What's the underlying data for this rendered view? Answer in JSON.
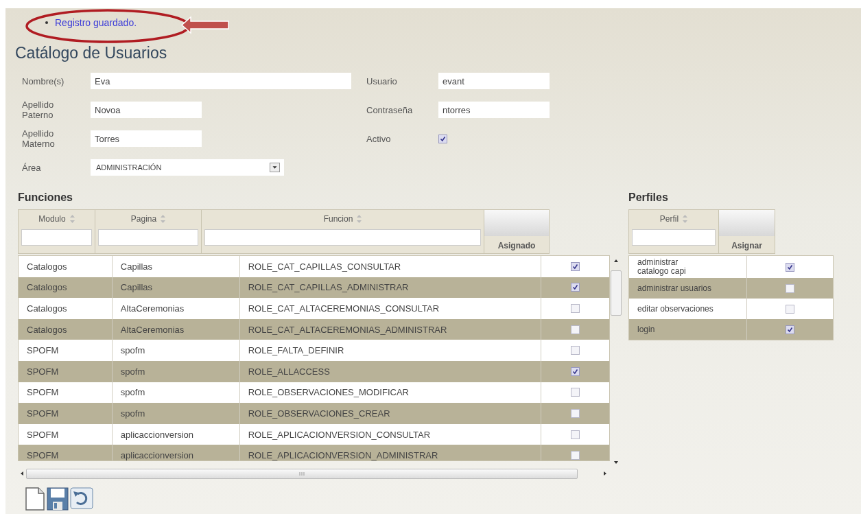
{
  "message": "Registro guardado.",
  "title": "Catálogo de Usuarios",
  "form": {
    "left": [
      {
        "label": "Nombre(s)",
        "value": "Eva",
        "wide": true
      },
      {
        "label": "Apellido Paterno",
        "value": "Novoa",
        "wide": false
      },
      {
        "label": "Apellido Materno",
        "value": "Torres",
        "wide": false
      }
    ],
    "right": [
      {
        "label": "Usuario",
        "value": "evant",
        "kind": "text"
      },
      {
        "label": "Contraseña",
        "value": "ntorres",
        "kind": "text"
      },
      {
        "label": "Activo",
        "checked": true,
        "kind": "checkbox"
      }
    ],
    "area": {
      "label": "Área",
      "value": "ADMINISTRACIÓN"
    }
  },
  "funciones": {
    "title": "Funciones",
    "columns": [
      "Modulo",
      "Pagina",
      "Funcion",
      "Asignado"
    ],
    "rows": [
      {
        "modulo": "Catalogos",
        "pagina": "Capillas",
        "funcion": "ROLE_CAT_CAPILLAS_CONSULTAR",
        "checked": true
      },
      {
        "modulo": "Catalogos",
        "pagina": "Capillas",
        "funcion": "ROLE_CAT_CAPILLAS_ADMINISTRAR",
        "checked": true
      },
      {
        "modulo": "Catalogos",
        "pagina": "AltaCeremonias",
        "funcion": "ROLE_CAT_ALTACEREMONIAS_CONSULTAR",
        "checked": false
      },
      {
        "modulo": "Catalogos",
        "pagina": "AltaCeremonias",
        "funcion": "ROLE_CAT_ALTACEREMONIAS_ADMINISTRAR",
        "checked": false
      },
      {
        "modulo": "SPOFM",
        "pagina": "spofm",
        "funcion": "ROLE_FALTA_DEFINIR",
        "checked": false
      },
      {
        "modulo": "SPOFM",
        "pagina": "spofm",
        "funcion": "ROLE_ALLACCESS",
        "checked": true
      },
      {
        "modulo": "SPOFM",
        "pagina": "spofm",
        "funcion": "ROLE_OBSERVACIONES_MODIFICAR",
        "checked": false
      },
      {
        "modulo": "SPOFM",
        "pagina": "spofm",
        "funcion": "ROLE_OBSERVACIONES_CREAR",
        "checked": false
      },
      {
        "modulo": "SPOFM",
        "pagina": "aplicaccionversion",
        "funcion": "ROLE_APLICACIONVERSION_CONSULTAR",
        "checked": false
      },
      {
        "modulo": "SPOFM",
        "pagina": "aplicaccionversion",
        "funcion": "ROLE_APLICACIONVERSION_ADMINISTRAR",
        "checked": false
      }
    ]
  },
  "perfiles": {
    "title": "Perfiles",
    "columns": [
      "Perfil",
      "Asignar"
    ],
    "rows": [
      {
        "perfil": "administrar catalogo capi",
        "checked": true
      },
      {
        "perfil": "administrar usuarios",
        "checked": false
      },
      {
        "perfil": "editar observaciones",
        "checked": false
      },
      {
        "perfil": "login",
        "checked": true
      }
    ]
  }
}
